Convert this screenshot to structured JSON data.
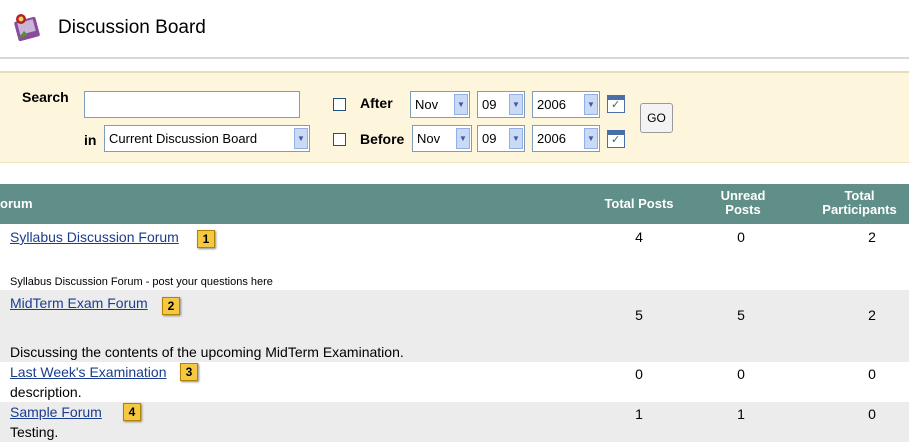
{
  "header": {
    "title": "Discussion Board",
    "icon": "discussion-board-icon"
  },
  "search": {
    "label": "Search",
    "in_label": "in",
    "query_value": "",
    "scope_value": "Current Discussion Board",
    "after_label": "After",
    "before_label": "Before",
    "after": {
      "month": "Nov",
      "day": "09",
      "year": "2006"
    },
    "before": {
      "month": "Nov",
      "day": "09",
      "year": "2006"
    },
    "go_label": "GO"
  },
  "table": {
    "headers": {
      "forum": "orum",
      "total_posts": "Total Posts",
      "unread_posts": "Unread Posts",
      "total_participants": "Total Participants"
    },
    "rows": [
      {
        "name": "Syllabus Discussion Forum",
        "badge": "1",
        "total_posts": "4",
        "unread": "0",
        "participants": "2",
        "description": "Syllabus Discussion Forum - post your questions here"
      },
      {
        "name": "MidTerm Exam Forum",
        "badge": "2",
        "total_posts": "5",
        "unread": "5",
        "participants": "2",
        "description": "Discussing the contents of the upcoming MidTerm Examination."
      },
      {
        "name": "Last Week's Examination",
        "badge": "3",
        "total_posts": "0",
        "unread": "0",
        "participants": "0",
        "description": "description."
      },
      {
        "name": "Sample Forum",
        "badge": "4",
        "total_posts": "1",
        "unread": "1",
        "participants": "0",
        "description": "Testing."
      }
    ]
  },
  "colors": {
    "header_bg": "#5f8f88",
    "search_bg": "#fdf6dc",
    "link": "#1a3d8f",
    "badge": "#f5c842"
  }
}
